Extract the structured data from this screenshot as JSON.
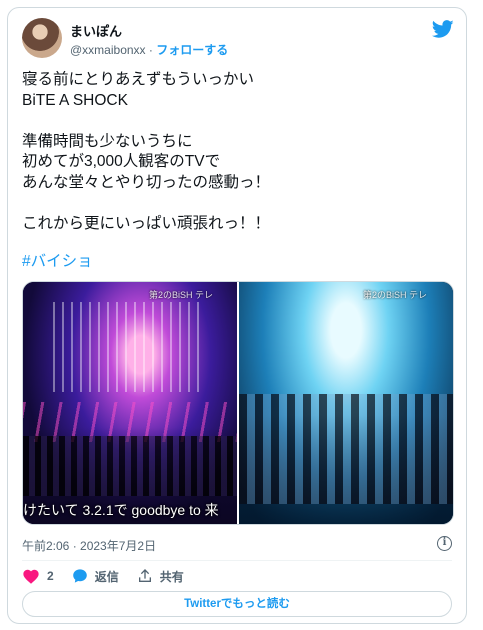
{
  "user": {
    "display_name": "まいぽん",
    "handle": "@xxmaibonxx",
    "separator": "·",
    "follow_label": "フォローする"
  },
  "tweet": {
    "text": "寝る前にとりあえずもういっかい\nBiTE A SHOCK\n\n準備時間も少ないうちに\n初めてが3,000人観客のTVで\nあんな堂々とやり切ったの感動っ！\n\nこれから更にいっぱい頑張れっ！！",
    "hashtag": "#バイショ",
    "timestamp": "午前2:06 · 2023年7月2日"
  },
  "media": {
    "image1": {
      "overlay": "第2のBiSH テレ",
      "caption": "けたいて 3.2.1で goodbye to 来"
    },
    "image2": {
      "overlay": "第2のBiSH テレ"
    }
  },
  "actions": {
    "like_count": "2",
    "reply_label": "返信",
    "share_label": "共有"
  },
  "read_more_label": "Twitterでもっと読む",
  "colors": {
    "accent": "#1d9bf0",
    "like": "#f91880",
    "text": "#0f1419",
    "muted": "#536471",
    "border": "#cfd9de"
  },
  "icons": [
    "twitter-bird-icon",
    "heart-icon",
    "reply-bubble-icon",
    "share-icon",
    "info-icon"
  ]
}
